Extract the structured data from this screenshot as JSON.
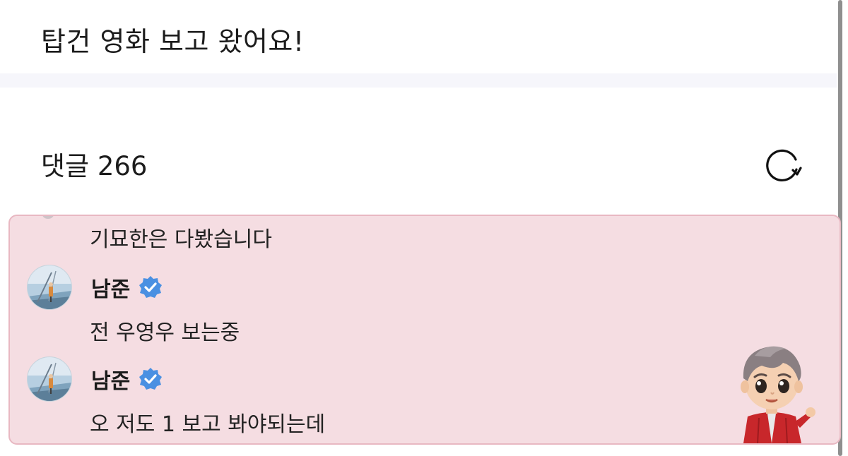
{
  "post": {
    "title": "탑건 영화 보고 왔어요!"
  },
  "comments_section": {
    "header": "댓글 266",
    "refresh_icon": "refresh-icon"
  },
  "thread": {
    "first_text": "기묘한은 다봤습니다",
    "replies": [
      {
        "author": "남준",
        "verified": true,
        "text": "전 우영우 보는중"
      },
      {
        "author": "남준",
        "verified": true,
        "text": "오 저도 1 보고 봐야되는데"
      }
    ]
  },
  "colors": {
    "highlight_bg": "#f5dde2",
    "highlight_border": "#e8b8c2",
    "verified_badge": "#4a90e2"
  }
}
